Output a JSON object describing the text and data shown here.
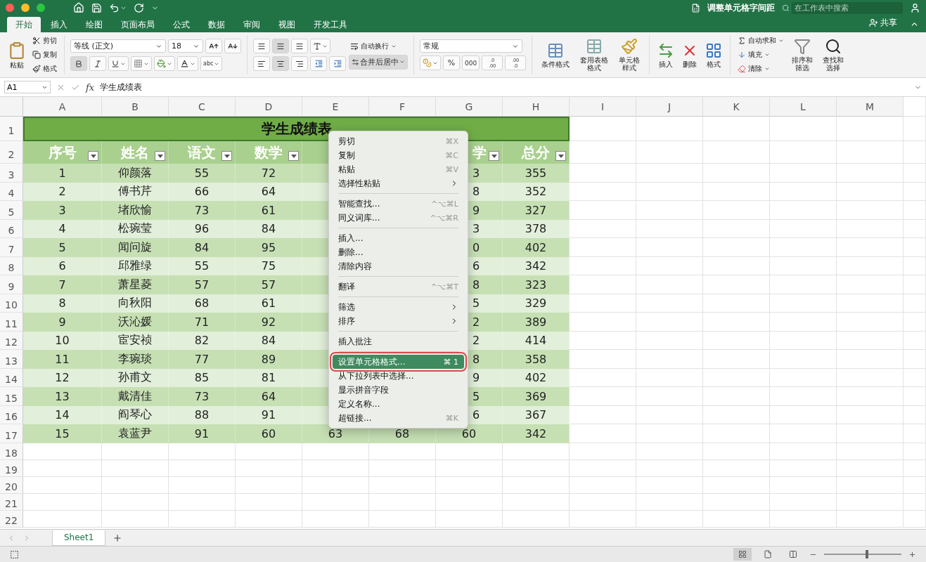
{
  "window": {
    "title": "调整单元格字间距",
    "search_placeholder": "在工作表中搜索",
    "share": "共享"
  },
  "menu_tabs": [
    {
      "label": "开始",
      "selected": true
    },
    {
      "label": "插入",
      "selected": false
    },
    {
      "label": "绘图",
      "selected": false
    },
    {
      "label": "页面布局",
      "selected": false
    },
    {
      "label": "公式",
      "selected": false
    },
    {
      "label": "数据",
      "selected": false
    },
    {
      "label": "审阅",
      "selected": false
    },
    {
      "label": "视图",
      "selected": false
    },
    {
      "label": "开发工具",
      "selected": false
    }
  ],
  "ribbon": {
    "paste": "粘贴",
    "cut": "剪切",
    "copy": "复制",
    "format_painter": "格式",
    "font_name": "等线 (正文)",
    "font_size": "18",
    "bold": true,
    "italic": false,
    "underline": false,
    "phonetic": "abc",
    "align_middle": true,
    "align_center": true,
    "wrap_text": "自动换行",
    "merge_center": "合并后居中",
    "merge_on": true,
    "number_format": "常规",
    "percent": "%",
    "thousands": "000",
    "decimal_increase": [
      ".0",
      ".00"
    ],
    "decimal_decrease": [
      ".00",
      ".0"
    ],
    "styles": [
      "条件格式",
      "套用表格格式",
      "单元格样式"
    ],
    "cells": [
      "插入",
      "删除",
      "格式"
    ],
    "autosum": "自动求和",
    "fill": "填充",
    "clear": "清除",
    "sort_filter": "排序和筛选",
    "find_select": "查找和选择"
  },
  "formula_bar": {
    "name_box": "A1",
    "fx": "fx",
    "content": "学生成绩表"
  },
  "columns": [
    "A",
    "B",
    "C",
    "D",
    "E",
    "F",
    "G",
    "H",
    "I",
    "J",
    "K",
    "L",
    "M"
  ],
  "row_numbers": [
    "1",
    "2",
    "3",
    "4",
    "5",
    "6",
    "7",
    "8",
    "9",
    "10",
    "11",
    "12",
    "13",
    "14",
    "15",
    "16",
    "17",
    "18",
    "19",
    "20",
    "21",
    "22"
  ],
  "sheet": {
    "title": "学生成绩表",
    "header": {
      "A": "序号",
      "B": "姓名",
      "C": "语文",
      "D": "数学",
      "G": "学",
      "H": "总分"
    },
    "rows": [
      {
        "A": "1",
        "B": "仰颜落",
        "C": "55",
        "D": "72",
        "G": "3",
        "H": "355"
      },
      {
        "A": "2",
        "B": "傅书芹",
        "C": "66",
        "D": "64",
        "G": "8",
        "H": "352"
      },
      {
        "A": "3",
        "B": "堵欣愉",
        "C": "73",
        "D": "61",
        "G": "9",
        "H": "327"
      },
      {
        "A": "4",
        "B": "松琬莹",
        "C": "96",
        "D": "84",
        "G": "3",
        "H": "378"
      },
      {
        "A": "5",
        "B": "闻问旋",
        "C": "84",
        "D": "95",
        "G": "0",
        "H": "402"
      },
      {
        "A": "6",
        "B": "邱雅绿",
        "C": "55",
        "D": "75",
        "G": "6",
        "H": "342"
      },
      {
        "A": "7",
        "B": "萧星菱",
        "C": "57",
        "D": "57",
        "G": "8",
        "H": "323"
      },
      {
        "A": "8",
        "B": "向秋阳",
        "C": "68",
        "D": "61",
        "G": "5",
        "H": "329"
      },
      {
        "A": "9",
        "B": "沃沁媛",
        "C": "71",
        "D": "92",
        "G": "2",
        "H": "389"
      },
      {
        "A": "10",
        "B": "宦安祯",
        "C": "82",
        "D": "84",
        "G": "2",
        "H": "414"
      },
      {
        "A": "11",
        "B": "李琬琰",
        "C": "77",
        "D": "89",
        "G": "8",
        "H": "358"
      },
      {
        "A": "12",
        "B": "孙甫文",
        "C": "85",
        "D": "81",
        "G": "9",
        "H": "402"
      },
      {
        "A": "13",
        "B": "戴清佳",
        "C": "73",
        "D": "64",
        "G": "5",
        "H": "369"
      },
      {
        "A": "14",
        "B": "阎琴心",
        "C": "88",
        "D": "91",
        "G": "6",
        "H": "367"
      },
      {
        "A": "15",
        "B": "袁蓝尹",
        "C": "91",
        "D": "60",
        "E": "63",
        "F": "68",
        "G": "60",
        "H": "342"
      }
    ]
  },
  "context_menu": [
    {
      "items": [
        {
          "label": "剪切",
          "shortcut": "⌘X",
          "submenu": false,
          "selected": false,
          "outlined": false
        },
        {
          "label": "复制",
          "shortcut": "⌘C",
          "submenu": false,
          "selected": false,
          "outlined": false
        },
        {
          "label": "粘贴",
          "shortcut": "⌘V",
          "submenu": false,
          "selected": false,
          "outlined": false
        },
        {
          "label": "选择性粘贴",
          "submenu": true,
          "selected": false,
          "outlined": false
        }
      ]
    },
    {
      "items": [
        {
          "label": "智能查找...",
          "shortcut": "^⌥⌘L",
          "submenu": false,
          "selected": false,
          "outlined": false
        },
        {
          "label": "同义词库...",
          "shortcut": "^⌥⌘R",
          "submenu": false,
          "selected": false,
          "outlined": false
        }
      ]
    },
    {
      "items": [
        {
          "label": "插入...",
          "submenu": false,
          "selected": false,
          "outlined": false
        },
        {
          "label": "删除...",
          "submenu": false,
          "selected": false,
          "outlined": false
        },
        {
          "label": "清除内容",
          "submenu": false,
          "selected": false,
          "outlined": false
        }
      ]
    },
    {
      "items": [
        {
          "label": "翻译",
          "shortcut": "^⌥⌘T",
          "submenu": false,
          "selected": false,
          "outlined": false
        }
      ]
    },
    {
      "items": [
        {
          "label": "筛选",
          "submenu": true,
          "selected": false,
          "outlined": false
        },
        {
          "label": "排序",
          "submenu": true,
          "selected": false,
          "outlined": false
        }
      ]
    },
    {
      "items": [
        {
          "label": "插入批注",
          "submenu": false,
          "selected": false,
          "outlined": false
        }
      ]
    },
    {
      "items": [
        {
          "label": "设置单元格格式...",
          "shortcut": "⌘ 1",
          "submenu": false,
          "selected": true,
          "outlined": true
        },
        {
          "label": "从下拉列表中选择...",
          "submenu": false,
          "selected": false,
          "outlined": false
        },
        {
          "label": "显示拼音字段",
          "submenu": false,
          "selected": false,
          "outlined": false
        },
        {
          "label": "定义名称...",
          "submenu": false,
          "selected": false,
          "outlined": false
        },
        {
          "label": "超链接...",
          "shortcut": "⌘K",
          "submenu": false,
          "selected": false,
          "outlined": false
        }
      ]
    }
  ],
  "sheet_tabs": [
    {
      "label": "Sheet1",
      "selected": true
    }
  ],
  "status_bar": {
    "views": [
      {
        "kind": "normal",
        "selected": true
      },
      {
        "kind": "page",
        "selected": false
      },
      {
        "kind": "break",
        "selected": false
      }
    ],
    "zoom": {
      "level": 0.55
    }
  }
}
